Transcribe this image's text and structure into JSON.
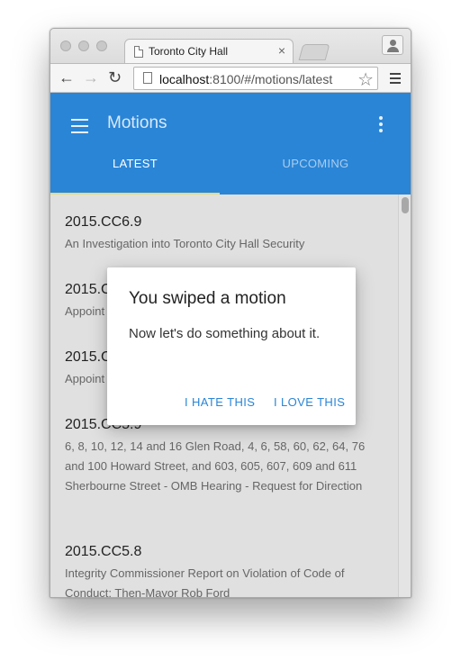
{
  "browser": {
    "tab_title": "Toronto City Hall",
    "tab_close": "×",
    "url_host": "localhost",
    "url_rest": ":8100/#/motions/latest",
    "icons": {
      "back": "back-arrow-icon",
      "forward": "forward-arrow-icon",
      "reload": "reload-icon",
      "star": "bookmark-star-icon",
      "menu": "browser-menu-icon",
      "profile": "profile-icon"
    },
    "glyphs": {
      "back": "←",
      "forward": "→",
      "reload": "↻",
      "star": "☆"
    }
  },
  "app": {
    "title": "Motions",
    "header_color": "#2a85d6",
    "tabs": [
      {
        "label": "LATEST",
        "active": true
      },
      {
        "label": "UPCOMING",
        "active": false
      }
    ]
  },
  "motions": [
    {
      "id": "2015.CC6.9",
      "description": "An Investigation into Toronto City Hall Security"
    },
    {
      "id": "2015.C",
      "description": "Appoint"
    },
    {
      "id": "2015.C",
      "description": "Appoint"
    },
    {
      "id": "2015.CC5.9",
      "description": "6, 8, 10, 12, 14 and 16 Glen Road, 4, 6, 58, 60, 62, 64, 76 and 100 Howard Street, and 603, 605, 607, 609 and 611 Sherbourne Street - OMB Hearing - Request for Direction"
    },
    {
      "id": "2015.CC5.8",
      "description": "Integrity Commissioner Report on Violation of Code of Conduct: Then-Mayor Rob Ford"
    }
  ],
  "dialog": {
    "title": "You swiped a motion",
    "body": "Now let's do something about it.",
    "buttons": {
      "hate": "I HATE THIS",
      "love": "I LOVE THIS"
    },
    "accent_color": "#2a85d6"
  }
}
